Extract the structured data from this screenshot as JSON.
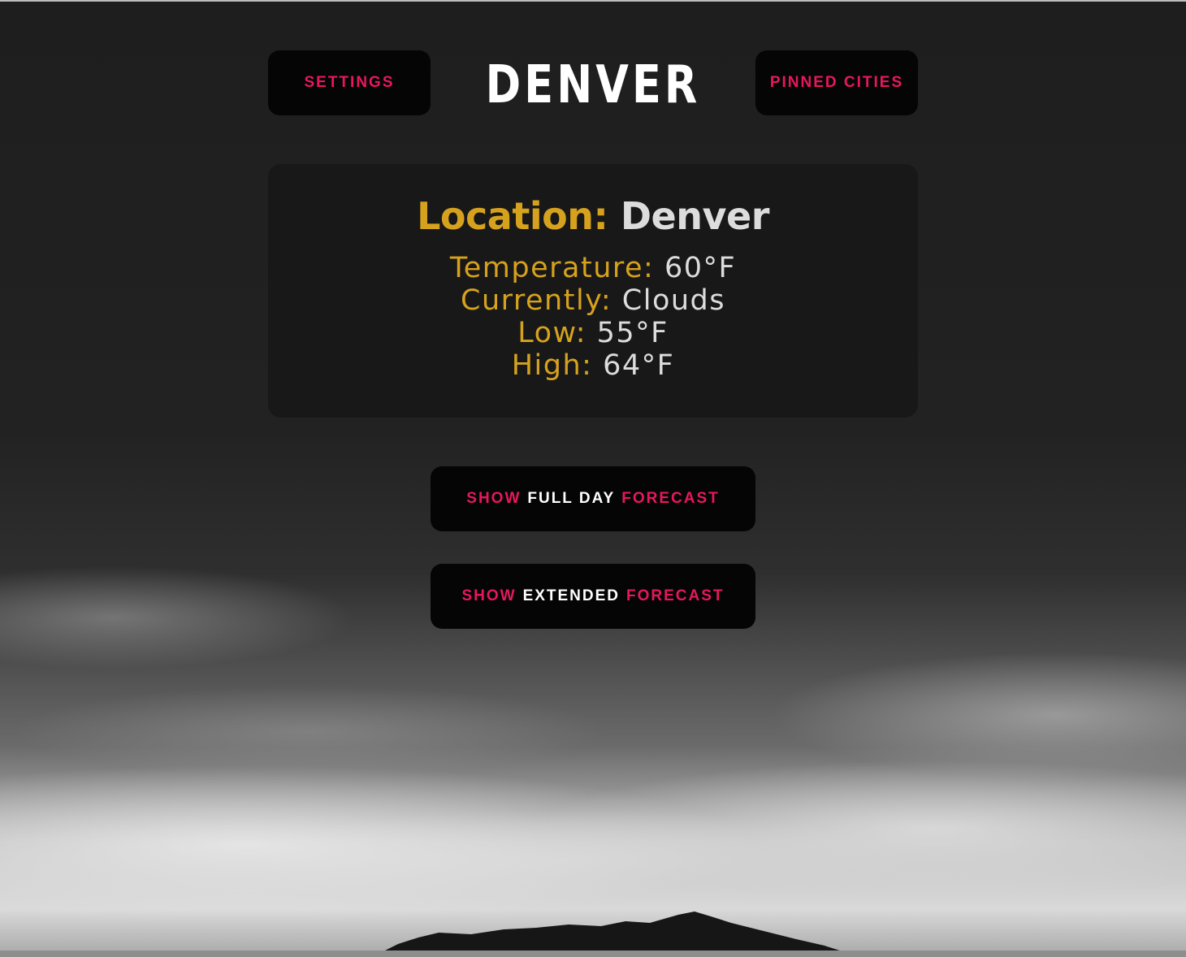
{
  "header": {
    "settings_label": "SETTINGS",
    "city_title": "DENVER",
    "pinned_label": "PINNED CITIES"
  },
  "weather": {
    "location_label": "Location:",
    "location_value": "Denver",
    "temperature_label": "Temperature:",
    "temperature_value": "60°F",
    "currently_label": "Currently:",
    "currently_value": "Clouds",
    "low_label": "Low:",
    "low_value": "55°F",
    "high_label": "High:",
    "high_value": "64°F"
  },
  "forecast_buttons": {
    "full_day": {
      "show": "SHOW",
      "middle": "FULL DAY",
      "forecast": "FORECAST"
    },
    "extended": {
      "show": "SHOW",
      "middle": "EXTENDED",
      "forecast": "FORECAST"
    }
  },
  "colors": {
    "accent_pink": "#e8175d",
    "label_gold": "#d6a21e",
    "button_bg": "#050505",
    "card_bg": "#181818"
  }
}
